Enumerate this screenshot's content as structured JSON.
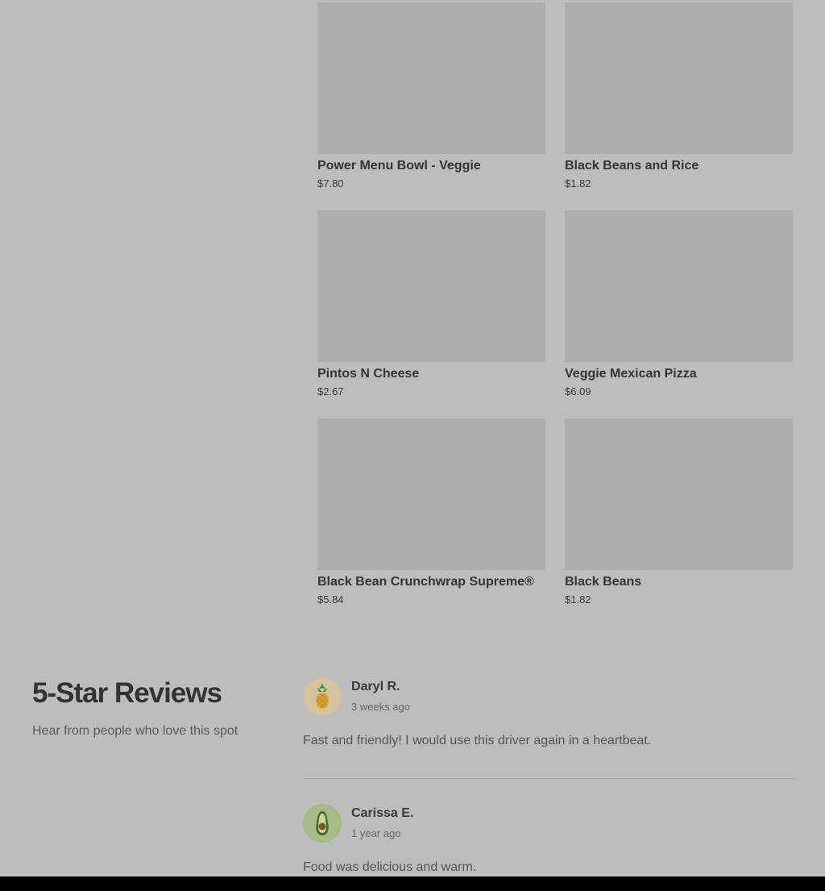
{
  "menu_items": [
    {
      "name": "Power Menu Bowl - Veggie",
      "price": "$7.80"
    },
    {
      "name": "Black Beans and Rice",
      "price": "$1.82"
    },
    {
      "name": "Pintos N Cheese",
      "price": "$2.67"
    },
    {
      "name": "Veggie Mexican Pizza",
      "price": "$6.09"
    },
    {
      "name": "Black Bean Crunchwrap Supreme®",
      "price": "$5.84"
    },
    {
      "name": "Black Beans",
      "price": "$1.82"
    }
  ],
  "reviews_section": {
    "title": "5-Star Reviews",
    "subtitle": "Hear from people who love this spot"
  },
  "reviews": [
    {
      "name": "Daryl R.",
      "time": "3 weeks ago",
      "text": "Fast and friendly! I would use this driver again in a heartbeat.",
      "avatar_icon": "pineapple-icon"
    },
    {
      "name": "Carissa E.",
      "time": "1 year ago",
      "text": "Food was delicious and warm.",
      "avatar_icon": "avocado-icon"
    }
  ],
  "colors": {
    "overlay_background": "#bdbdbd",
    "image_placeholder": "#aeaeae",
    "bottom_bar": "#000000"
  }
}
